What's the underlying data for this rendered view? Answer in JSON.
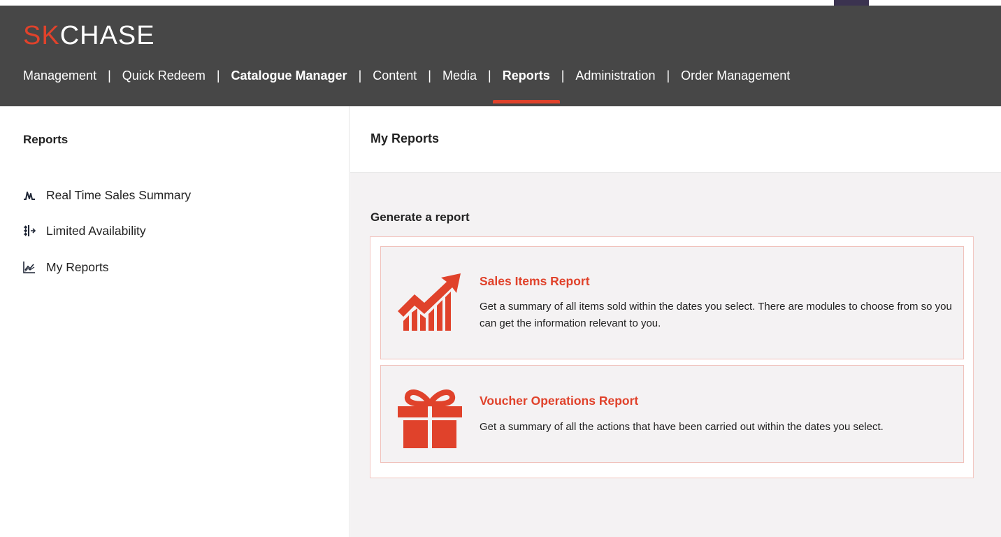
{
  "brand": {
    "logo_accent": "SK",
    "logo_main": "CHASE",
    "accent_color": "#e0422b",
    "header_color": "#474747"
  },
  "nav": {
    "items": [
      {
        "label": "Management",
        "bold": false
      },
      {
        "label": "Quick Redeem",
        "bold": false
      },
      {
        "label": "Catalogue Manager",
        "bold": true
      },
      {
        "label": "Content",
        "bold": false
      },
      {
        "label": "Media",
        "bold": false
      },
      {
        "label": "Reports",
        "bold": true,
        "active": true
      },
      {
        "label": "Administration",
        "bold": false
      },
      {
        "label": "Order Management",
        "bold": false
      }
    ],
    "separator": "|"
  },
  "sidebar": {
    "title": "Reports",
    "items": [
      {
        "label": "Real Time Sales Summary",
        "icon": "pulse-chart-icon"
      },
      {
        "label": "Limited Availability",
        "icon": "split-arrows-icon"
      },
      {
        "label": "My Reports",
        "icon": "line-chart-icon"
      }
    ]
  },
  "main": {
    "title": "My Reports",
    "section_title": "Generate a report",
    "cards": [
      {
        "title": "Sales Items Report",
        "description": "Get a summary of all items sold within the dates you select. There are modules to choose from so you can get the information relevant to you.",
        "icon": "growth-chart-icon"
      },
      {
        "title": "Voucher Operations Report",
        "description": "Get a summary of all the actions that have been carried out within the dates you select.",
        "icon": "gift-icon"
      }
    ]
  }
}
